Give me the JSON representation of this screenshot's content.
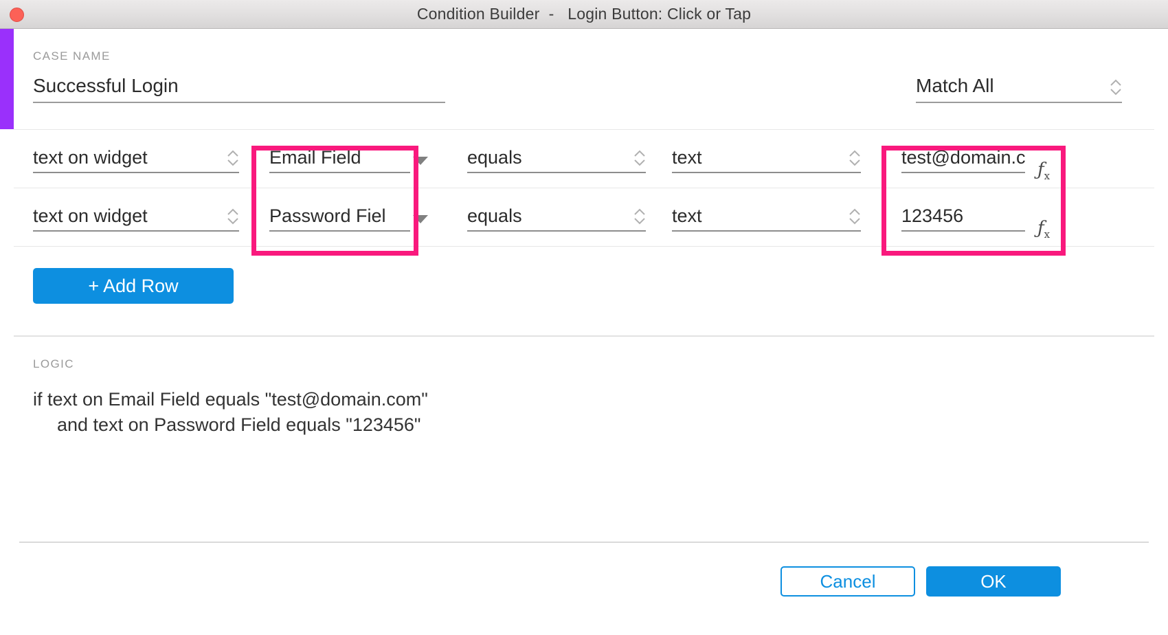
{
  "window": {
    "title": "Condition Builder  -   Login Button: Click or Tap",
    "close_icon": "close-button",
    "accent_color": "#9a30fb",
    "highlight_color": "#f9197d",
    "primary_color": "#0d8fe0"
  },
  "case": {
    "label": "CASE NAME",
    "value": "Successful Login",
    "placeholder": "Case name"
  },
  "match": {
    "value": "Match All",
    "stepper_icon": "stepper-chevrons-icon"
  },
  "conditions": {
    "rows": [
      {
        "widget": "text on widget",
        "target": "Email Field",
        "operator": "equals",
        "type": "text",
        "value": "test@domain.c",
        "fx_icon": "function-icon"
      },
      {
        "widget": "text on widget",
        "target": "Password Fiel",
        "operator": "equals",
        "type": "text",
        "value": "123456",
        "fx_icon": "function-icon"
      }
    ],
    "add_row_label": "+ Add Row"
  },
  "logic": {
    "label": "LOGIC",
    "lines": [
      "if text on Email Field equals \"test@domain.com\"",
      "and text on Password Field equals \"123456\""
    ]
  },
  "footer": {
    "cancel_label": "Cancel",
    "ok_label": "OK"
  }
}
